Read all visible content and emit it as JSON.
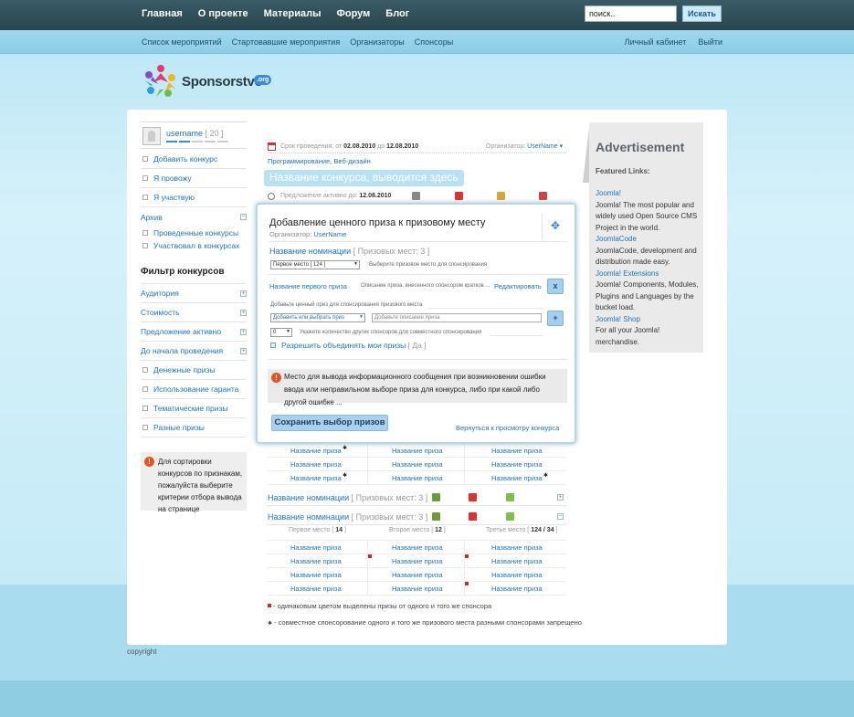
{
  "topnav": {
    "items": [
      "Главная",
      "О проекте",
      "Материалы",
      "Форум",
      "Блог"
    ]
  },
  "search": {
    "value": "поиск..",
    "button": "Искать"
  },
  "subnav": {
    "items": [
      "Список мероприятий",
      "Стартовавшие мероприятия",
      "Организаторы",
      "Спонсоры"
    ],
    "right": [
      "Личный кабинет",
      "Выйти"
    ]
  },
  "logo": {
    "text": "Sponsorstvo",
    "badge": ".org"
  },
  "user": {
    "name": "username",
    "score": "[ 20 ]"
  },
  "sidebar": {
    "actions": [
      "Добавить конкурс",
      "Я провожу",
      "Я участвую"
    ],
    "archive": "Архив",
    "archive_items": [
      "Проведенные конкурсы",
      "Участвовал в конкурсах"
    ],
    "filter_title": "Фильтр конкурсов",
    "filters": [
      "Аудитория",
      "Стоимость",
      "Предложение активно",
      "До начала проведения"
    ],
    "checks": [
      "Денежные призы",
      "Использование гаранта",
      "Тематические призы",
      "Разные призы"
    ],
    "hint": "Для сортировки конкурсов по признакам, пожалуйста выберите критерии отбора вывода на странице"
  },
  "contest": {
    "dates_label": "Срок проведения: от",
    "date_from": "02.08.2010",
    "date_to_label": "до",
    "date_to": "12.08.2010",
    "organizer_label": "Организатор:",
    "organizer": "UserName",
    "tags": "Программирование, Веб-дизайн",
    "title": "Название конкурса, выводится здесь",
    "active_label": "Предложение активно до:",
    "active_date": "12.08.2010"
  },
  "modal": {
    "title": "Добавление ценного приза к призовому месту",
    "org_label": "Организатор:",
    "org": "UserName",
    "nomination": "Название номинации",
    "nomination_places": "[ Призовых мест: 3 ]",
    "place_select": "Первое место [ 124 ]",
    "place_hint": "Выберите призовое место для спонсирования",
    "first_prize": "Название первого приза",
    "prize_desc": "Описание приза, внесенного спонсором кратков ...",
    "edit": "Редактировать",
    "remove": "x",
    "add_label": "Добавьте ценный приз для спонсирования призового места",
    "add_select": "Добавить или выбрать приз",
    "desc_placeholder": "Добавьте описание приза",
    "add": "+",
    "count_select": "0",
    "count_hint": "Укажите количество других спонсоров для совместного спонсирования",
    "merge_label": "Разрешить объединять мои призы",
    "merge_value": "[ Да ]",
    "message": "Место для вывода информационного сообщения при возникновении ошибки ввода или неправильном выборе приза для конкурса, либо при какой либо другой ошибке ...",
    "save": "Сохранить выбор призов",
    "back": "Вернуться к просмотру конкурса"
  },
  "grid": {
    "prize": "Название приза",
    "nomination": "Название номинации",
    "nomination_places": "[ Призовых мест: 3 ]",
    "places": [
      "Первое место [",
      "14",
      "]",
      "Второе место [",
      "12",
      "]",
      "Третье место [",
      "124 / 34",
      "]"
    ]
  },
  "legend": {
    "line1": "- одинаковым цветом выделены призы от одного и того же спонсора",
    "line2": "- совместное спонсорование одного и того же призового места разными спонсорами запрещено"
  },
  "ad": {
    "title": "Advertisement",
    "subtitle": "Featured Links:",
    "links": [
      {
        "link": "Joomla!",
        "text": "Joomla! The most popular and widely used Open Source CMS Project in the world."
      },
      {
        "link": "JoomlaCode",
        "text": "JoomlaCode, development and distribution made easy."
      },
      {
        "link": "Joomla! Extensions",
        "text": "Joomla! Components, Modules, Plugins and Languages by the bucket load."
      },
      {
        "link": "Joomla! Shop",
        "text": "For all your Joomla! merchandise."
      }
    ]
  },
  "footer": {
    "copyright": "copyright"
  },
  "colors": {
    "accent": "#1d74b8",
    "topbar": "#2f4f5a",
    "button": "#a9d0ee",
    "error": "#e8521f"
  }
}
